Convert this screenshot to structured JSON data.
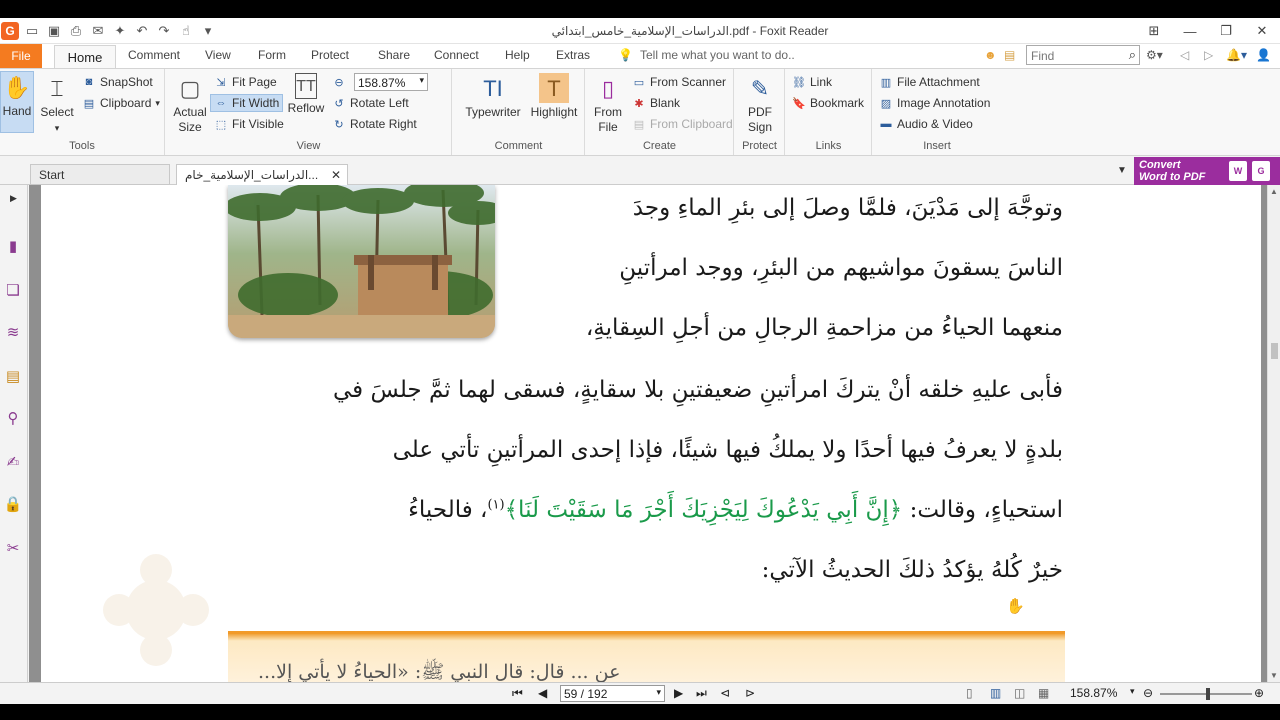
{
  "window": {
    "title": "الدراسات_الإسلامية_خامس_ابتدائي.pdf - Foxit Reader"
  },
  "tabs": {
    "file": "File",
    "home": "Home",
    "comment": "Comment",
    "view": "View",
    "form": "Form",
    "protect": "Protect",
    "share": "Share",
    "connect": "Connect",
    "help": "Help",
    "extras": "Extras",
    "tell_me": "Tell me what you want to do..",
    "find_placeholder": "Find"
  },
  "ribbon": {
    "tools": {
      "label": "Tools",
      "hand": "Hand",
      "select": "Select",
      "snapshot": "SnapShot",
      "clipboard": "Clipboard"
    },
    "view": {
      "label": "View",
      "actual_size_1": "Actual",
      "actual_size_2": "Size",
      "fit_page": "Fit Page",
      "fit_width": "Fit Width",
      "fit_visible": "Fit Visible",
      "reflow": "Reflow",
      "zoom_value": "158.87%",
      "rotate_left": "Rotate Left",
      "rotate_right": "Rotate Right"
    },
    "comment": {
      "label": "Comment",
      "typewriter": "Typewriter",
      "highlight": "Highlight"
    },
    "create": {
      "label": "Create",
      "from_file_1": "From",
      "from_file_2": "File",
      "from_scanner": "From Scanner",
      "blank": "Blank",
      "from_clipboard": "From Clipboard"
    },
    "protect": {
      "label": "Protect",
      "pdf_sign_1": "PDF",
      "pdf_sign_2": "Sign"
    },
    "links": {
      "label": "Links",
      "link": "Link",
      "bookmark": "Bookmark"
    },
    "insert": {
      "label": "Insert",
      "file_attachment": "File Attachment",
      "image_annotation": "Image Annotation",
      "audio_video": "Audio & Video"
    }
  },
  "doc_tabs": {
    "start": "Start",
    "current": "الدراسات_الإسلامية_خام..."
  },
  "convert": {
    "line1": "Convert",
    "line2": "Word to PDF"
  },
  "page_text": {
    "line1": "وتوجَّهَ إلى مَدْيَنَ، فلمَّا وصلَ إلى بئرِ الماءِ وجدَ",
    "line2": "الناسَ يسقونَ مواشيهم من البئرِ، ووجد امرأتينِ",
    "line3": "منعهما الحياءُ من مزاحمةِ الرجالِ من أجلِ السِقايةِ،",
    "line4": "فأبى عليهِ خلقه أنْ يتركَ امرأتينِ ضعيفتينِ بلا سقايةٍ، فسقى لهما ثمَّ جلسَ في",
    "line5": "بلدةٍ لا يعرفُ فيها أحدًا ولا يملكُ فيها شيئًا، فإذا إحدى المرأتينِ تأتي على",
    "line6a": "استحياءٍ، وقالت: ",
    "line6_quote": "﴿إِنَّ أَبِي يَدْعُوكَ لِيَجْزِيَكَ أَجْرَ مَا سَقَيْتَ لَنَا﴾",
    "line6_footnote": "(١)",
    "line6b": "، فالحياءُ",
    "line7": "خيرٌ كُلهُ يؤكدُ ذلكَ الحديثُ الآتي:",
    "hadith_partial": "عن ... قال: قال النبي ﷺ: «الحياءُ لا يأتي إلا..."
  },
  "status": {
    "page": "59 / 192",
    "zoom": "158.87%"
  }
}
